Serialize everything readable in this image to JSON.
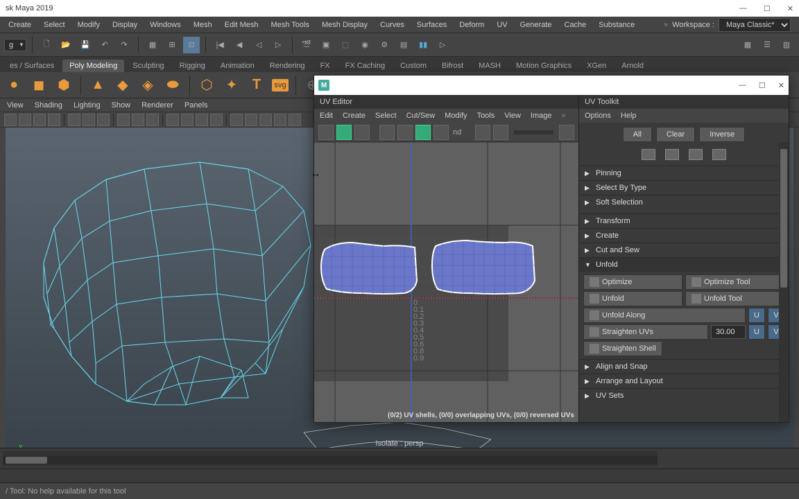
{
  "titlebar": {
    "title": "sk Maya 2019"
  },
  "mainmenu": [
    "Create",
    "Select",
    "Modify",
    "Display",
    "Windows",
    "Mesh",
    "Edit Mesh",
    "Mesh Tools",
    "Mesh Display",
    "Curves",
    "Surfaces",
    "Deform",
    "UV",
    "Generate",
    "Cache",
    "Substance"
  ],
  "workspace": {
    "label": "Workspace :",
    "value": "Maya Classic*"
  },
  "toolbar_dropdown": "g",
  "shelftabs": [
    "es / Surfaces",
    "Poly Modeling",
    "Sculpting",
    "Rigging",
    "Animation",
    "Rendering",
    "FX",
    "FX Caching",
    "Custom",
    "Bifrost",
    "MASH",
    "Motion Graphics",
    "XGen",
    "Arnold"
  ],
  "shelftabs_active": 1,
  "shelf_icons": [
    "◈",
    "▣",
    "⬢",
    "◉",
    "▲",
    "◆",
    "◈",
    "━",
    "T",
    "svg",
    "⊕",
    "⊙"
  ],
  "panelmenu": [
    "View",
    "Shading",
    "Lighting",
    "Show",
    "Renderer",
    "Panels"
  ],
  "isolate": "Isolate : persp",
  "uv": {
    "editor_title": "UV Editor",
    "toolkit_title": "UV Toolkit",
    "menu_left": [
      "Edit",
      "Create",
      "Select",
      "Cut/Sew",
      "Modify",
      "Tools",
      "View",
      "Image"
    ],
    "menu_right": [
      "Options",
      "Help"
    ],
    "status": "(0/2) UV shells, (0/0) overlapping UVs, (0/0) reversed UVs",
    "nd_label": "nd"
  },
  "toolkit": {
    "select_buttons": [
      "All",
      "Clear",
      "Inverse"
    ],
    "sections_collapsed_top": [
      "Pinning",
      "Select By Type",
      "Soft Selection"
    ],
    "sections_collapsed_mid": [
      "Transform",
      "Create",
      "Cut and Sew"
    ],
    "unfold": {
      "title": "Unfold",
      "optimize": "Optimize",
      "optimize_tool": "Optimize Tool",
      "unfold": "Unfold",
      "unfold_tool": "Unfold Tool",
      "unfold_along": "Unfold Along",
      "u": "U",
      "v": "V",
      "straighten_uvs": "Straighten UVs",
      "straighten_val": "30.00",
      "straighten_shell": "Straighten Shell"
    },
    "sections_collapsed_bot": [
      "Align and Snap",
      "Arrange and Layout",
      "UV Sets"
    ]
  },
  "statusbar": {
    "help": "/ Tool: No help available for this tool"
  }
}
